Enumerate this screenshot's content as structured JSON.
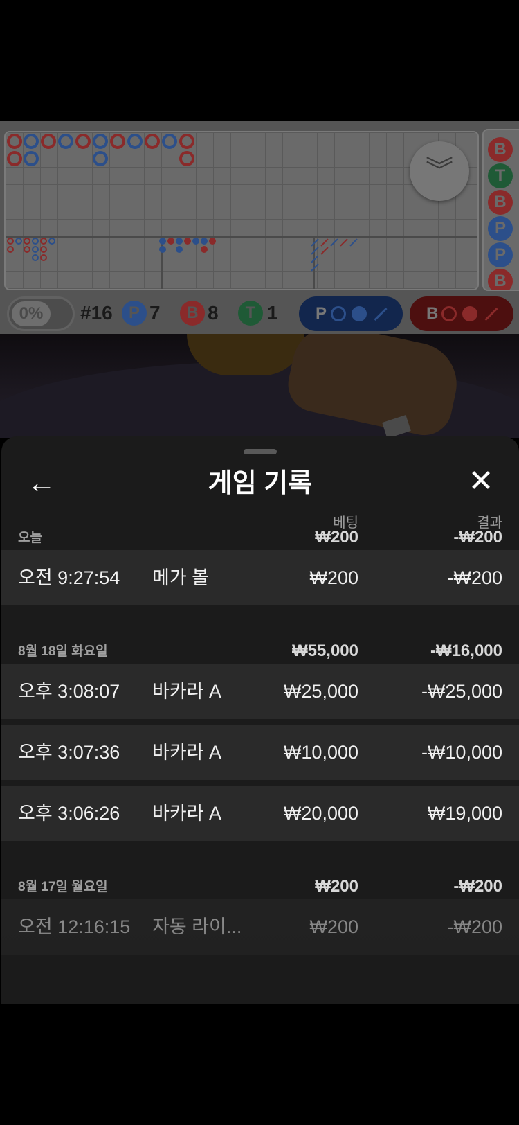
{
  "scoreboard": {
    "percent": "0%",
    "round": "#16",
    "player": {
      "letter": "P",
      "count": "7"
    },
    "banker": {
      "letter": "B",
      "count": "8"
    },
    "tie": {
      "letter": "T",
      "count": "1"
    },
    "player_ask_label": "P",
    "banker_ask_label": "B",
    "side_beads": [
      "B",
      "T",
      "B",
      "P",
      "P",
      "B"
    ]
  },
  "sheet": {
    "title": "게임 기록",
    "col_bet": "베팅",
    "col_result": "결과"
  },
  "groups": [
    {
      "date": "오늘",
      "bet_total": "₩200",
      "result_total": "-₩200",
      "rows": [
        {
          "time": "오전 9:27:54",
          "game": "메가 볼",
          "bet": "₩200",
          "result": "-₩200"
        }
      ]
    },
    {
      "date": "8월 18일 화요일",
      "bet_total": "₩55,000",
      "result_total": "-₩16,000",
      "rows": [
        {
          "time": "오후 3:08:07",
          "game": "바카라 A",
          "bet": "₩25,000",
          "result": "-₩25,000"
        },
        {
          "time": "오후 3:07:36",
          "game": "바카라 A",
          "bet": "₩10,000",
          "result": "-₩10,000"
        },
        {
          "time": "오후 3:06:26",
          "game": "바카라 A",
          "bet": "₩20,000",
          "result": "₩19,000"
        }
      ]
    },
    {
      "date": "8월 17일 월요일",
      "bet_total": "₩200",
      "result_total": "-₩200",
      "rows": [
        {
          "time": "오전 12:16:15",
          "game": "자동 라이...",
          "bet": "₩200",
          "result": "-₩200"
        }
      ]
    }
  ],
  "icons": {
    "back": "arrow-left-icon",
    "close": "close-icon",
    "collapse": "chevron-double-down-icon"
  }
}
